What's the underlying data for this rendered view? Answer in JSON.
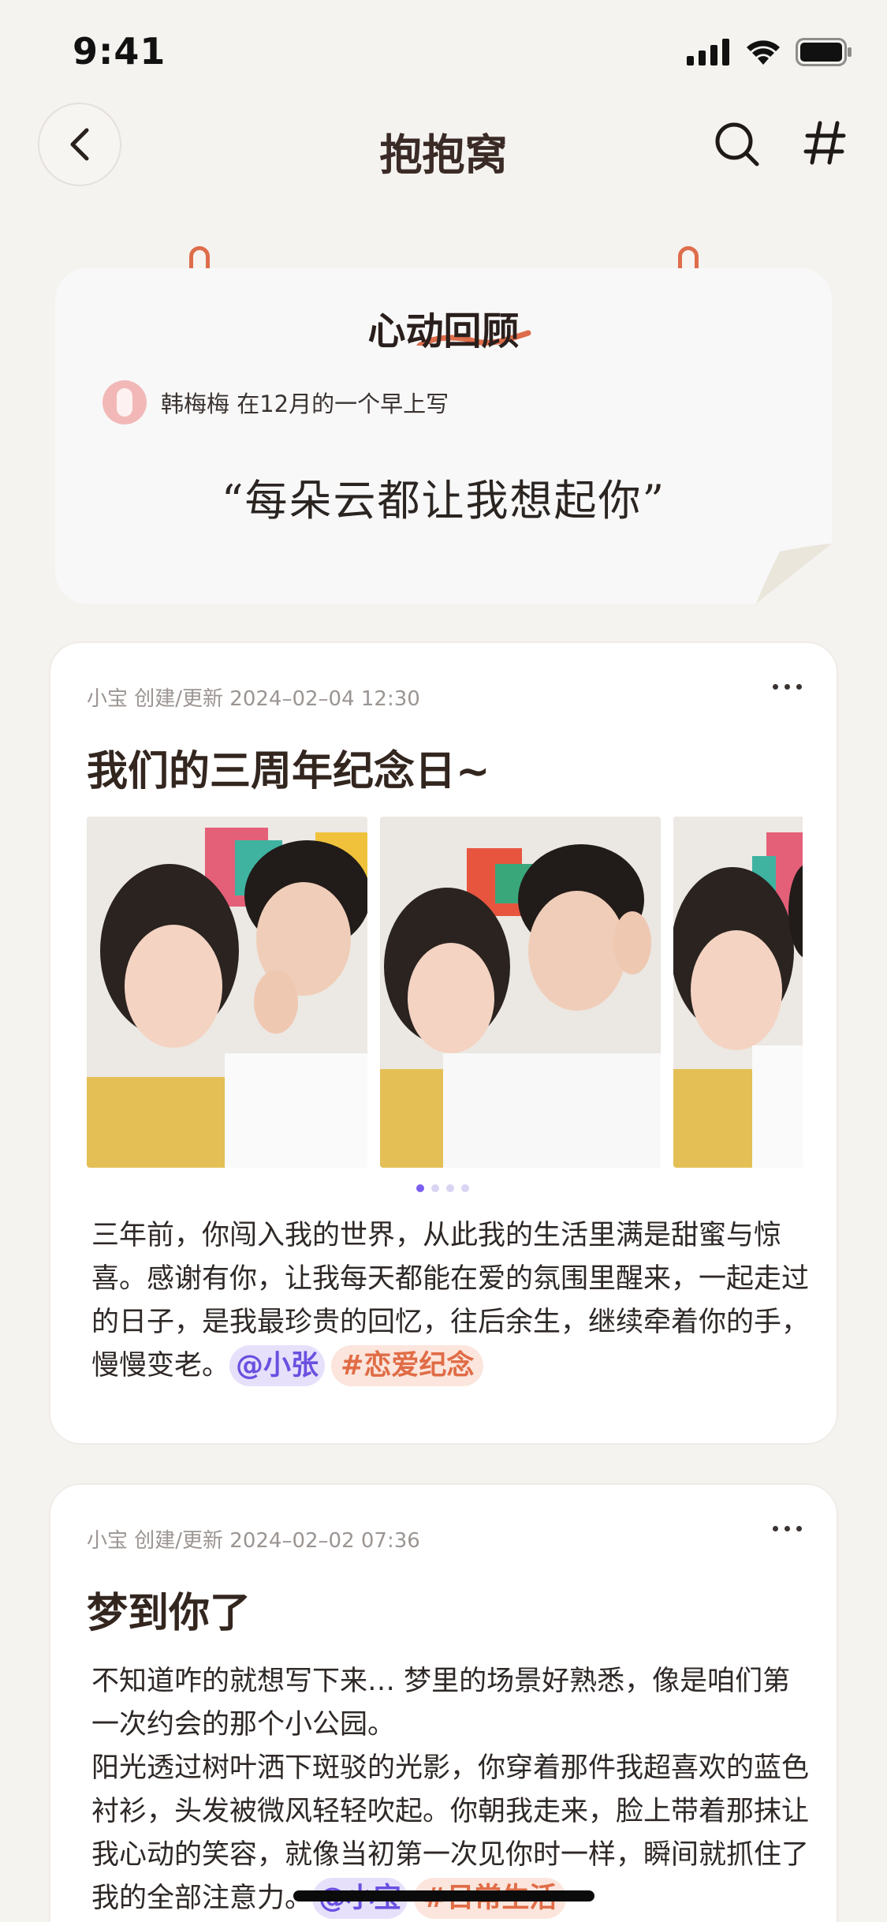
{
  "status_bar": {
    "time": "9:41"
  },
  "nav": {
    "title": "抱抱窝"
  },
  "review": {
    "title": "心动回顾",
    "author": "韩梅梅 在12月的一个早上写",
    "quote": "“每朵云都让我想起你”"
  },
  "posts": [
    {
      "meta": "小宝 创建/更新 2024–02–04 12:30",
      "title": "我们的三周年纪念日~",
      "body": "三年前，你闯入我的世界，从此我的生活里满是甜蜜与惊喜。感谢有你，让我每天都能在爱的氛围里醒来，一起走过的日子，是我最珍贵的回忆，往后余生，继续牵着你的手，慢慢变老。",
      "mention": "@小张",
      "topic": "#恋爱纪念"
    },
    {
      "meta": "小宝 创建/更新 2024–02–02 07:36",
      "title": "梦到你了",
      "body_line1": "不知道咋的就想写下来… 梦里的场景好熟悉，像是咱们第一次约会的那个小公园。",
      "body_line2": "阳光透过树叶洒下斑驳的光影，你穿着那件我超喜欢的蓝色衬衫，头发被微风轻轻吹起。你朝我走来，脸上带着那抹让我心动的笑容，就像当初第一次见你时一样，瞬间就抓住了我的全部注意力。",
      "mention": "@小宝",
      "topic": "#日常生活"
    }
  ],
  "colors": {
    "accent_orange": "#de6d4b",
    "accent_purple": "#6a4fe0",
    "background": "#f5f3f0"
  }
}
